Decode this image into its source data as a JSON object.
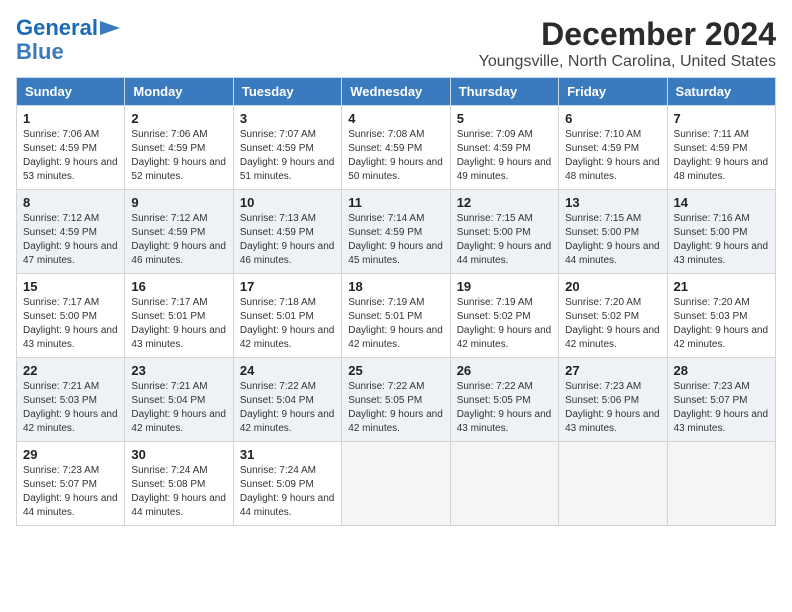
{
  "header": {
    "logo_line1": "General",
    "logo_line2": "Blue",
    "month": "December 2024",
    "location": "Youngsville, North Carolina, United States"
  },
  "weekdays": [
    "Sunday",
    "Monday",
    "Tuesday",
    "Wednesday",
    "Thursday",
    "Friday",
    "Saturday"
  ],
  "weeks": [
    [
      {
        "day": "1",
        "sunrise": "Sunrise: 7:06 AM",
        "sunset": "Sunset: 4:59 PM",
        "daylight": "Daylight: 9 hours and 53 minutes."
      },
      {
        "day": "2",
        "sunrise": "Sunrise: 7:06 AM",
        "sunset": "Sunset: 4:59 PM",
        "daylight": "Daylight: 9 hours and 52 minutes."
      },
      {
        "day": "3",
        "sunrise": "Sunrise: 7:07 AM",
        "sunset": "Sunset: 4:59 PM",
        "daylight": "Daylight: 9 hours and 51 minutes."
      },
      {
        "day": "4",
        "sunrise": "Sunrise: 7:08 AM",
        "sunset": "Sunset: 4:59 PM",
        "daylight": "Daylight: 9 hours and 50 minutes."
      },
      {
        "day": "5",
        "sunrise": "Sunrise: 7:09 AM",
        "sunset": "Sunset: 4:59 PM",
        "daylight": "Daylight: 9 hours and 49 minutes."
      },
      {
        "day": "6",
        "sunrise": "Sunrise: 7:10 AM",
        "sunset": "Sunset: 4:59 PM",
        "daylight": "Daylight: 9 hours and 48 minutes."
      },
      {
        "day": "7",
        "sunrise": "Sunrise: 7:11 AM",
        "sunset": "Sunset: 4:59 PM",
        "daylight": "Daylight: 9 hours and 48 minutes."
      }
    ],
    [
      {
        "day": "8",
        "sunrise": "Sunrise: 7:12 AM",
        "sunset": "Sunset: 4:59 PM",
        "daylight": "Daylight: 9 hours and 47 minutes."
      },
      {
        "day": "9",
        "sunrise": "Sunrise: 7:12 AM",
        "sunset": "Sunset: 4:59 PM",
        "daylight": "Daylight: 9 hours and 46 minutes."
      },
      {
        "day": "10",
        "sunrise": "Sunrise: 7:13 AM",
        "sunset": "Sunset: 4:59 PM",
        "daylight": "Daylight: 9 hours and 46 minutes."
      },
      {
        "day": "11",
        "sunrise": "Sunrise: 7:14 AM",
        "sunset": "Sunset: 4:59 PM",
        "daylight": "Daylight: 9 hours and 45 minutes."
      },
      {
        "day": "12",
        "sunrise": "Sunrise: 7:15 AM",
        "sunset": "Sunset: 5:00 PM",
        "daylight": "Daylight: 9 hours and 44 minutes."
      },
      {
        "day": "13",
        "sunrise": "Sunrise: 7:15 AM",
        "sunset": "Sunset: 5:00 PM",
        "daylight": "Daylight: 9 hours and 44 minutes."
      },
      {
        "day": "14",
        "sunrise": "Sunrise: 7:16 AM",
        "sunset": "Sunset: 5:00 PM",
        "daylight": "Daylight: 9 hours and 43 minutes."
      }
    ],
    [
      {
        "day": "15",
        "sunrise": "Sunrise: 7:17 AM",
        "sunset": "Sunset: 5:00 PM",
        "daylight": "Daylight: 9 hours and 43 minutes."
      },
      {
        "day": "16",
        "sunrise": "Sunrise: 7:17 AM",
        "sunset": "Sunset: 5:01 PM",
        "daylight": "Daylight: 9 hours and 43 minutes."
      },
      {
        "day": "17",
        "sunrise": "Sunrise: 7:18 AM",
        "sunset": "Sunset: 5:01 PM",
        "daylight": "Daylight: 9 hours and 42 minutes."
      },
      {
        "day": "18",
        "sunrise": "Sunrise: 7:19 AM",
        "sunset": "Sunset: 5:01 PM",
        "daylight": "Daylight: 9 hours and 42 minutes."
      },
      {
        "day": "19",
        "sunrise": "Sunrise: 7:19 AM",
        "sunset": "Sunset: 5:02 PM",
        "daylight": "Daylight: 9 hours and 42 minutes."
      },
      {
        "day": "20",
        "sunrise": "Sunrise: 7:20 AM",
        "sunset": "Sunset: 5:02 PM",
        "daylight": "Daylight: 9 hours and 42 minutes."
      },
      {
        "day": "21",
        "sunrise": "Sunrise: 7:20 AM",
        "sunset": "Sunset: 5:03 PM",
        "daylight": "Daylight: 9 hours and 42 minutes."
      }
    ],
    [
      {
        "day": "22",
        "sunrise": "Sunrise: 7:21 AM",
        "sunset": "Sunset: 5:03 PM",
        "daylight": "Daylight: 9 hours and 42 minutes."
      },
      {
        "day": "23",
        "sunrise": "Sunrise: 7:21 AM",
        "sunset": "Sunset: 5:04 PM",
        "daylight": "Daylight: 9 hours and 42 minutes."
      },
      {
        "day": "24",
        "sunrise": "Sunrise: 7:22 AM",
        "sunset": "Sunset: 5:04 PM",
        "daylight": "Daylight: 9 hours and 42 minutes."
      },
      {
        "day": "25",
        "sunrise": "Sunrise: 7:22 AM",
        "sunset": "Sunset: 5:05 PM",
        "daylight": "Daylight: 9 hours and 42 minutes."
      },
      {
        "day": "26",
        "sunrise": "Sunrise: 7:22 AM",
        "sunset": "Sunset: 5:05 PM",
        "daylight": "Daylight: 9 hours and 43 minutes."
      },
      {
        "day": "27",
        "sunrise": "Sunrise: 7:23 AM",
        "sunset": "Sunset: 5:06 PM",
        "daylight": "Daylight: 9 hours and 43 minutes."
      },
      {
        "day": "28",
        "sunrise": "Sunrise: 7:23 AM",
        "sunset": "Sunset: 5:07 PM",
        "daylight": "Daylight: 9 hours and 43 minutes."
      }
    ],
    [
      {
        "day": "29",
        "sunrise": "Sunrise: 7:23 AM",
        "sunset": "Sunset: 5:07 PM",
        "daylight": "Daylight: 9 hours and 44 minutes."
      },
      {
        "day": "30",
        "sunrise": "Sunrise: 7:24 AM",
        "sunset": "Sunset: 5:08 PM",
        "daylight": "Daylight: 9 hours and 44 minutes."
      },
      {
        "day": "31",
        "sunrise": "Sunrise: 7:24 AM",
        "sunset": "Sunset: 5:09 PM",
        "daylight": "Daylight: 9 hours and 44 minutes."
      },
      null,
      null,
      null,
      null
    ]
  ]
}
